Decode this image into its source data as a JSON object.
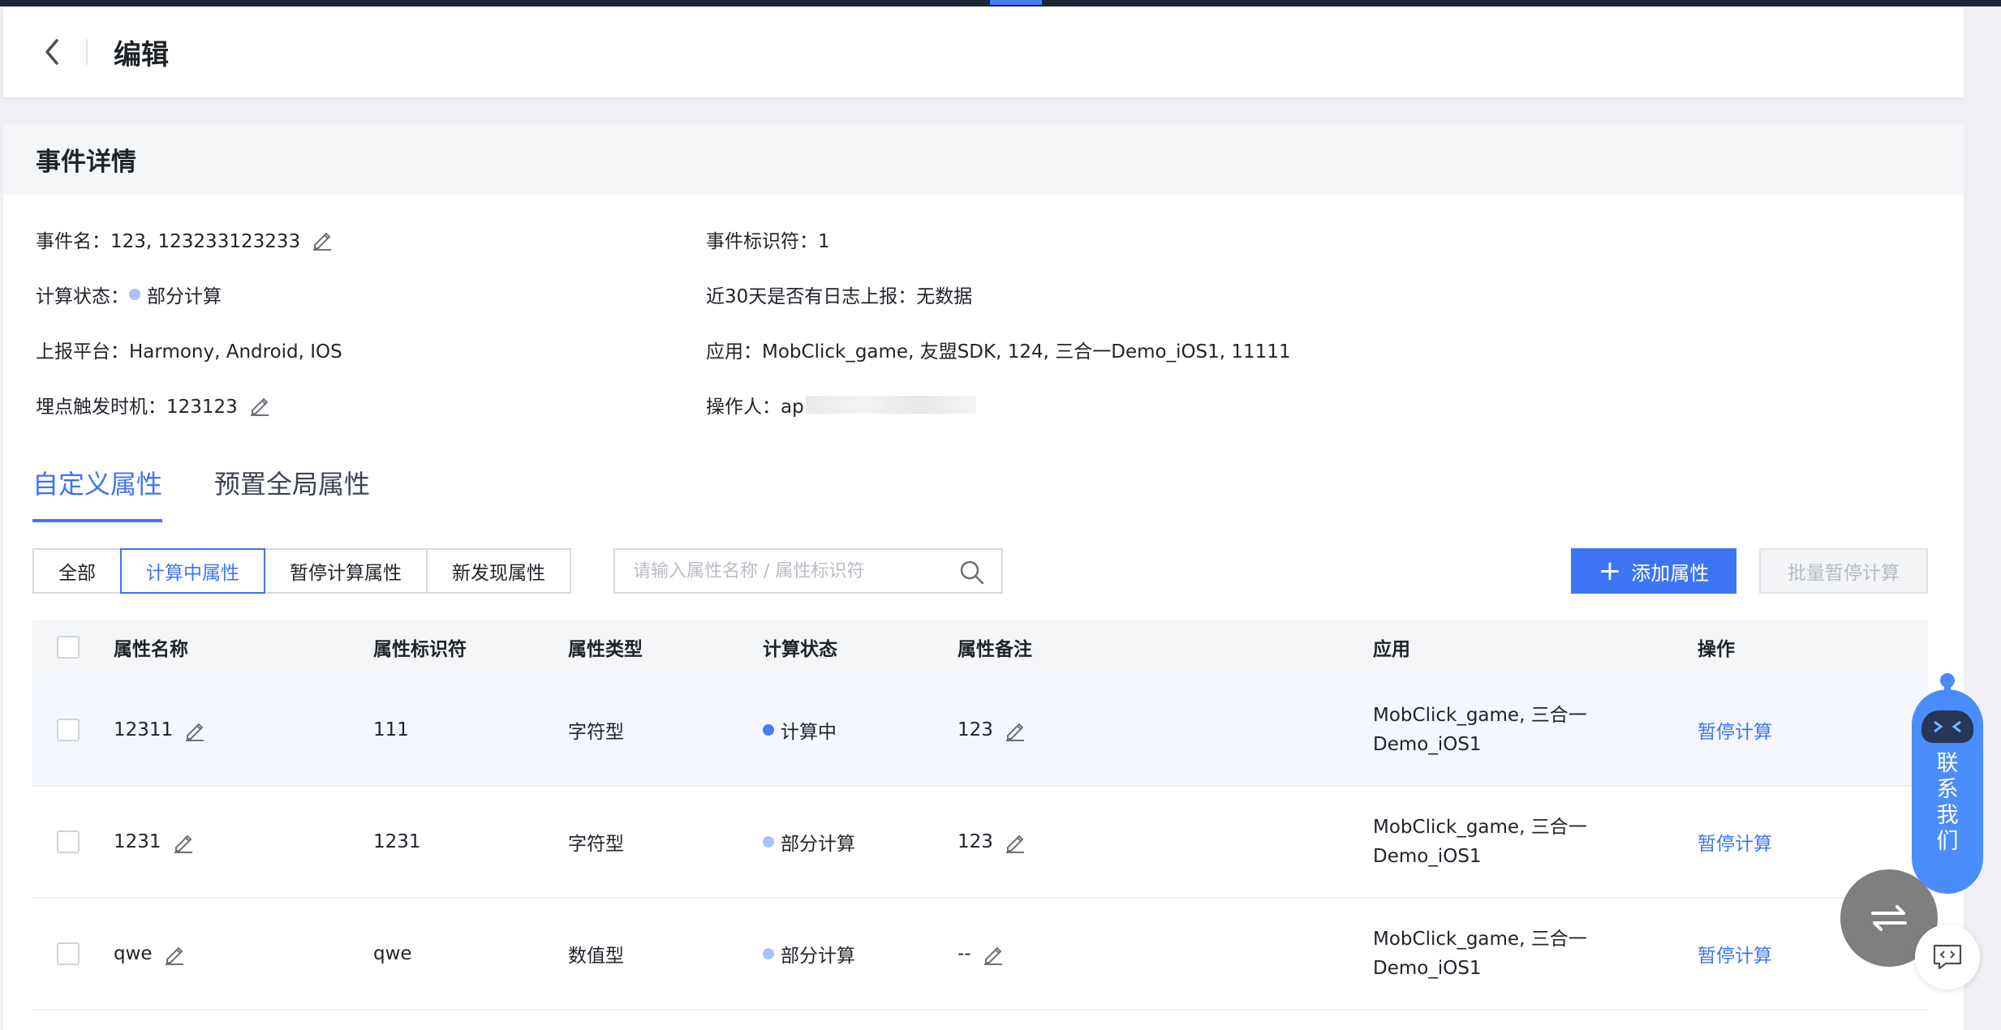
{
  "header": {
    "title": "编辑"
  },
  "card": {
    "title": "事件详情"
  },
  "info": {
    "event_name": "事件名：123, 123233123233",
    "event_id": "事件标识符：1",
    "calc_status_label": "计算状态：",
    "calc_status_value": "部分计算",
    "log_report": "近30天是否有日志上报：无数据",
    "platform": "上报平台：Harmony, Android, IOS",
    "app": "应用：MobClick_game, 友盟SDK, 124, 三合一Demo_iOS1, 11111",
    "trigger": "埋点触发时机：123123",
    "operator": "操作人：ap"
  },
  "tabs": [
    "自定义属性",
    "预置全局属性"
  ],
  "filters": [
    "全部",
    "计算中属性",
    "暂停计算属性",
    "新发现属性"
  ],
  "search": {
    "placeholder": "请输入属性名称 / 属性标识符"
  },
  "buttons": {
    "add": "添加属性",
    "batch": "批量暂停计算"
  },
  "table": {
    "headers": [
      "属性名称",
      "属性标识符",
      "属性类型",
      "计算状态",
      "属性备注",
      "应用",
      "操作"
    ],
    "rows": [
      {
        "name": "12311",
        "id": "111",
        "type": "字符型",
        "status": "计算中",
        "note": "123",
        "app": "MobClick_game, 三合一Demo_iOS1",
        "action": "暂停计算"
      },
      {
        "name": "1231",
        "id": "1231",
        "type": "字符型",
        "status": "部分计算",
        "note": "123",
        "app": "MobClick_game, 三合一Demo_iOS1",
        "action": "暂停计算"
      },
      {
        "name": "qwe",
        "id": "qwe",
        "type": "数值型",
        "status": "部分计算",
        "note": "--",
        "app": "MobClick_game, 三合一Demo_iOS1",
        "action": "暂停计算"
      }
    ]
  },
  "contact": {
    "label": "联系我们"
  },
  "icons": {
    "back": "chevron-left-icon",
    "edit": "pencil-icon",
    "search": "search-icon",
    "plus": "plus-icon",
    "swap": "swap-icon",
    "code": "code-icon",
    "robot": "robot-icon"
  },
  "colors": {
    "accent": "#3e74f4",
    "partial_dot": "#a9c1f7",
    "active_dot": "#4a7bf7",
    "contact": "#4a8dfa"
  }
}
